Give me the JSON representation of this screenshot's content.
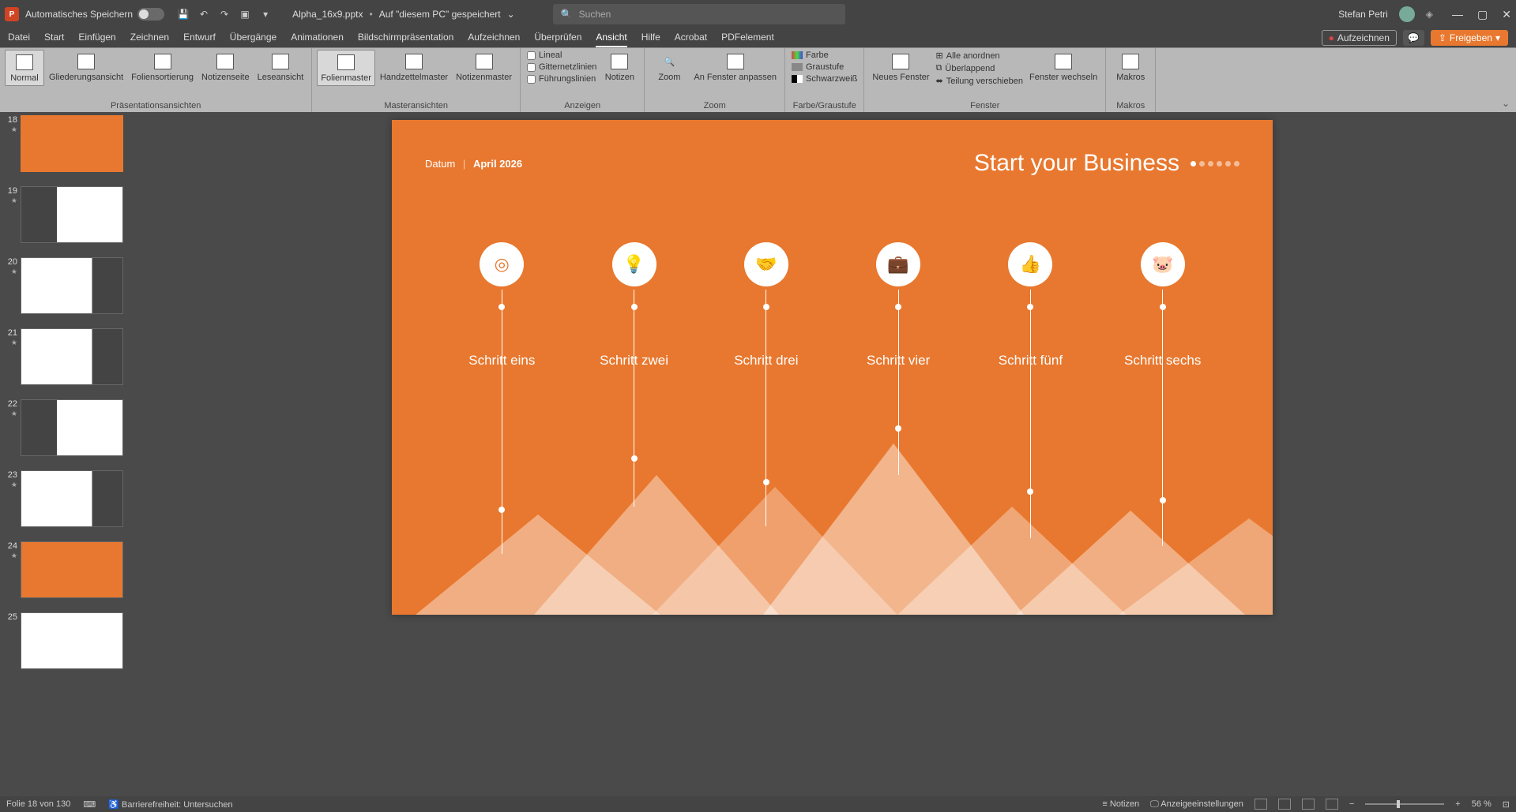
{
  "titlebar": {
    "autosave_label": "Automatisches Speichern",
    "filename": "Alpha_16x9.pptx",
    "save_location": "Auf \"diesem PC\" gespeichert",
    "search_placeholder": "Suchen",
    "username": "Stefan Petri"
  },
  "menu": {
    "tabs": [
      "Datei",
      "Start",
      "Einfügen",
      "Zeichnen",
      "Entwurf",
      "Übergänge",
      "Animationen",
      "Bildschirmpräsentation",
      "Aufzeichnen",
      "Überprüfen",
      "Ansicht",
      "Hilfe",
      "Acrobat",
      "PDFelement"
    ],
    "active_tab": "Ansicht",
    "record": "Aufzeichnen",
    "share": "Freigeben"
  },
  "ribbon": {
    "groups": {
      "presentation_views": {
        "label": "Präsentationsansichten",
        "items": [
          "Normal",
          "Gliederungsansicht",
          "Foliensortierung",
          "Notizenseite",
          "Leseansicht"
        ]
      },
      "master_views": {
        "label": "Masteransichten",
        "items": [
          "Folienmaster",
          "Handzettelmaster",
          "Notizenmaster"
        ]
      },
      "show": {
        "label": "Anzeigen",
        "lineal": "Lineal",
        "gitternetz": "Gitternetzlinien",
        "fuehrung": "Führungslinien",
        "notizen": "Notizen"
      },
      "zoom": {
        "label": "Zoom",
        "zoom": "Zoom",
        "fit": "An Fenster anpassen"
      },
      "color": {
        "label": "Farbe/Graustufe",
        "farbe": "Farbe",
        "graustufe": "Graustufe",
        "schwarzweiss": "Schwarzweiß"
      },
      "window": {
        "label": "Fenster",
        "neues": "Neues Fenster",
        "alle": "Alle anordnen",
        "ueberlappend": "Überlappend",
        "teilung": "Teilung verschieben",
        "wechseln": "Fenster wechseln"
      },
      "macros": {
        "label": "Makros",
        "btn": "Makros"
      }
    }
  },
  "thumbnails": [
    {
      "num": "18",
      "selected": true,
      "type": "orange"
    },
    {
      "num": "19",
      "selected": false,
      "type": "dark-white"
    },
    {
      "num": "20",
      "selected": false,
      "type": "white-dark"
    },
    {
      "num": "21",
      "selected": false,
      "type": "white-dark"
    },
    {
      "num": "22",
      "selected": false,
      "type": "dark-white"
    },
    {
      "num": "23",
      "selected": false,
      "type": "white-dark"
    },
    {
      "num": "24",
      "selected": false,
      "type": "orange"
    },
    {
      "num": "25",
      "selected": false,
      "type": "white"
    }
  ],
  "slide": {
    "date_label": "Datum",
    "date_value": "April 2026",
    "title": "Start your Business",
    "steps": [
      {
        "label": "Schritt eins",
        "icon": "coins",
        "line_height": 265
      },
      {
        "label": "Schritt zwei",
        "icon": "lamp",
        "line_height": 200
      },
      {
        "label": "Schritt drei",
        "icon": "handshake",
        "line_height": 232
      },
      {
        "label": "Schritt vier",
        "icon": "briefcase",
        "line_height": 162
      },
      {
        "label": "Schritt fünf",
        "icon": "thumbsup",
        "line_height": 245
      },
      {
        "label": "Schritt sechs",
        "icon": "piggybank",
        "line_height": 257
      }
    ]
  },
  "statusbar": {
    "slide_info": "Folie 18 von 130",
    "accessibility": "Barrierefreiheit: Untersuchen",
    "notizen": "Notizen",
    "anzeige": "Anzeigeeinstellungen",
    "zoom": "56 %"
  },
  "chart_data": {
    "type": "bar",
    "note": "Mountain-style step chart; heights are relative peak heights in slide pixels",
    "categories": [
      "Schritt eins",
      "Schritt zwei",
      "Schritt drei",
      "Schritt vier",
      "Schritt fünf",
      "Schritt sechs"
    ],
    "values": [
      130,
      180,
      170,
      220,
      140,
      135
    ],
    "title": "Start your Business"
  }
}
